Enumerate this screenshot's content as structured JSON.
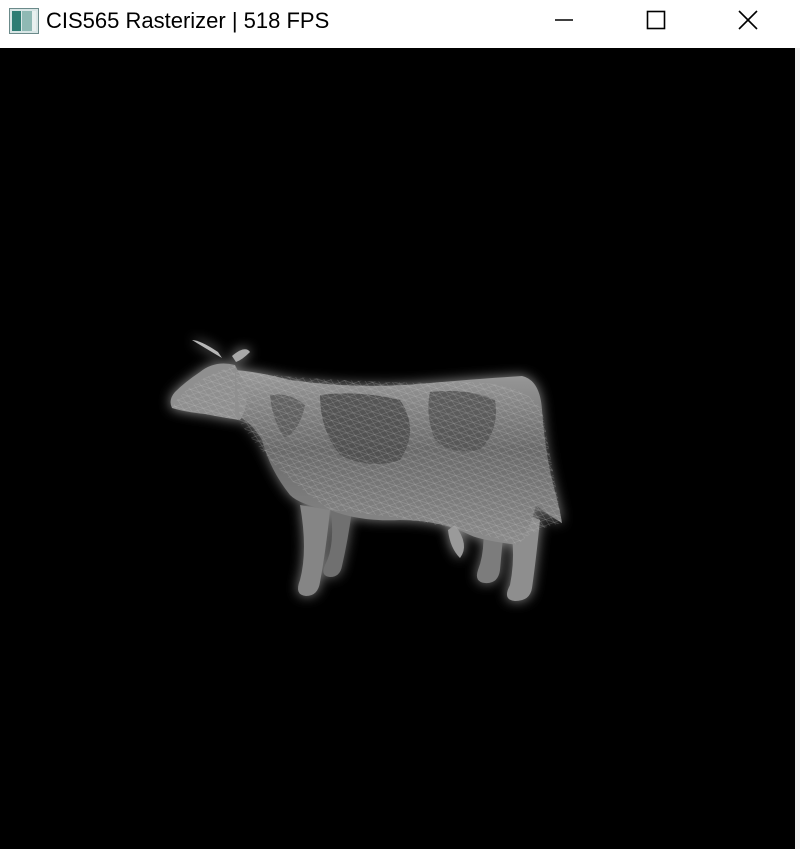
{
  "window": {
    "title": "CIS565 Rasterizer | 518 FPS",
    "app_icon": "app-window-icon",
    "controls": {
      "minimize_icon": "minimize-icon",
      "maximize_icon": "maximize-icon",
      "close_icon": "close-icon"
    }
  },
  "viewport": {
    "background": "#000000",
    "model": "cow-mesh",
    "shading": "grayscale-lambert-with-wireframe"
  },
  "colors": {
    "titlebar_bg": "#ffffff",
    "title_text": "#000000",
    "render_bg": "#000000"
  }
}
